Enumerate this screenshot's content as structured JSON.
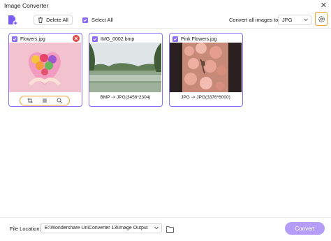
{
  "window": {
    "title": "Image Converter"
  },
  "toolbar": {
    "delete_all_label": "Delete All",
    "select_all_label": "Select All",
    "convert_all_label": "Convert all images to:",
    "format_value": "JPG"
  },
  "files": [
    {
      "name": "Flowers.jpg",
      "caption": ""
    },
    {
      "name": "IMG_0002.bmp",
      "caption": "BMP -> JPG(3456*2304)"
    },
    {
      "name": "Pink Flowers.jpg",
      "caption": "JPG -> JPG(3376*6000)"
    }
  ],
  "footer": {
    "location_label": "File Location:",
    "location_value": "E:\\Wondershare UniConverter 13\\Image Output",
    "convert_label": "Convert"
  },
  "colors": {
    "accent": "#8b6cf6",
    "highlight": "#f0a030",
    "danger": "#e04848",
    "convert_button": "#b49cf7"
  },
  "icons": [
    "add-image-icon",
    "trash-icon",
    "checkbox-icon",
    "chevron-down-icon",
    "settings-icon",
    "close-icon",
    "remove-icon",
    "crop-icon",
    "adjust-icon",
    "preview-icon",
    "folder-icon"
  ]
}
